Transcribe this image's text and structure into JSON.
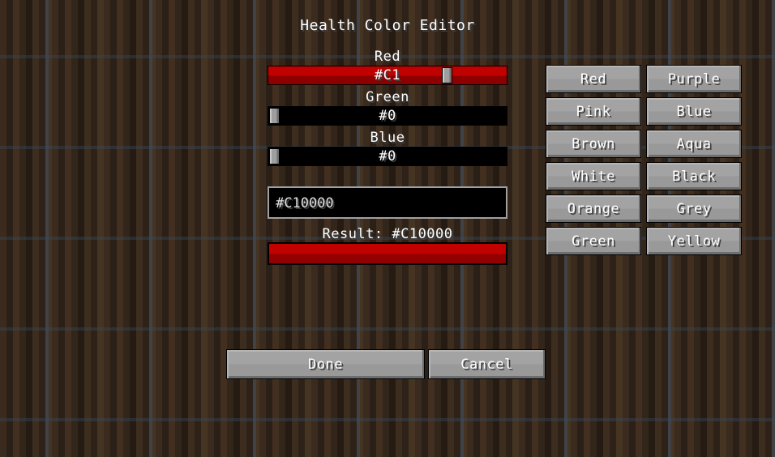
{
  "title": "Health Color Editor",
  "sliders": [
    {
      "label": "Red",
      "value_text": "#C1",
      "value": 193,
      "max": 255,
      "percent": 75.7,
      "track_style": "red"
    },
    {
      "label": "Green",
      "value_text": "#0",
      "value": 0,
      "max": 255,
      "percent": 0.0,
      "track_style": "black"
    },
    {
      "label": "Blue",
      "value_text": "#0",
      "value": 0,
      "max": 255,
      "percent": 0.0,
      "track_style": "black"
    }
  ],
  "hex_input": {
    "value": "#C10000",
    "placeholder": "#000000"
  },
  "result": {
    "label": "Result: #C10000",
    "color": "#C10000"
  },
  "presets": [
    {
      "label": "Red"
    },
    {
      "label": "Purple"
    },
    {
      "label": "Pink"
    },
    {
      "label": "Blue"
    },
    {
      "label": "Brown"
    },
    {
      "label": "Aqua"
    },
    {
      "label": "White"
    },
    {
      "label": "Black"
    },
    {
      "label": "Orange"
    },
    {
      "label": "Grey"
    },
    {
      "label": "Green"
    },
    {
      "label": "Yellow"
    }
  ],
  "actions": {
    "done_label": "Done",
    "cancel_label": "Cancel"
  }
}
